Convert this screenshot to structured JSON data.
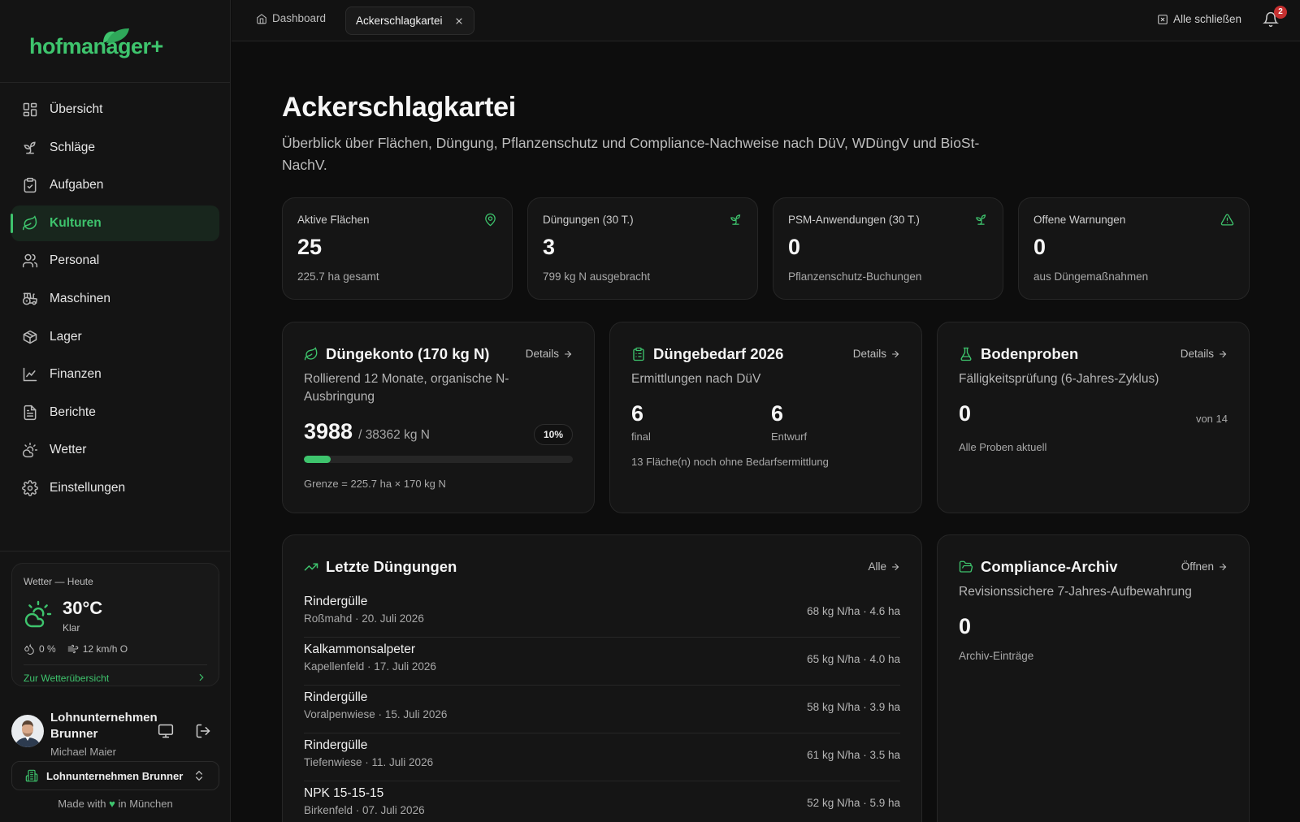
{
  "brand": {
    "name": "hofmanager+",
    "accent": "#3ec46d"
  },
  "nav": [
    {
      "label": "Übersicht",
      "icon": "grid-icon"
    },
    {
      "label": "Schläge",
      "icon": "sprout-icon"
    },
    {
      "label": "Aufgaben",
      "icon": "clipboard-check-icon"
    },
    {
      "label": "Kulturen",
      "icon": "leaf-icon",
      "active": true
    },
    {
      "label": "Personal",
      "icon": "users-icon"
    },
    {
      "label": "Maschinen",
      "icon": "tractor-icon"
    },
    {
      "label": "Lager",
      "icon": "package-icon"
    },
    {
      "label": "Finanzen",
      "icon": "chart-line-icon"
    },
    {
      "label": "Berichte",
      "icon": "file-text-icon"
    },
    {
      "label": "Wetter",
      "icon": "cloud-sun-icon"
    },
    {
      "label": "Einstellungen",
      "icon": "gear-icon"
    }
  ],
  "weather": {
    "title": "Wetter — Heute",
    "temp": "30°C",
    "condition": "Klar",
    "precip": "0 %",
    "wind": "12 km/h O",
    "link": "Zur Wetterübersicht"
  },
  "user": {
    "company": "Lohnunternehmen Brunner",
    "name": "Michael Maier",
    "org_select": "Lohnunternehmen Brunner"
  },
  "footer": {
    "made_prefix": "Made with",
    "heart": "♥",
    "made_suffix": "in München"
  },
  "topbar": {
    "tab_dashboard": "Dashboard",
    "tab_active": "Ackerschlagkartei",
    "close_all": "Alle schließen",
    "notifications": "2"
  },
  "page": {
    "title": "Ackerschlagkartei",
    "subtitle": "Überblick über Flächen, Düngung, Pflanzenschutz und Compliance-Nachweise nach DüV, WDüngV und BioSt-NachV."
  },
  "stats": [
    {
      "label": "Aktive Flächen",
      "value": "25",
      "sub": "225.7 ha gesamt",
      "icon": "map-pin-icon"
    },
    {
      "label": "Düngungen (30 T.)",
      "value": "3",
      "sub": "799 kg N ausgebracht",
      "icon": "sprout-icon"
    },
    {
      "label": "PSM-Anwendungen (30 T.)",
      "value": "0",
      "sub": "Pflanzenschutz-Buchungen",
      "icon": "sprout-icon"
    },
    {
      "label": "Offene Warnungen",
      "value": "0",
      "sub": "aus Düngemaßnahmen",
      "icon": "warning-icon"
    }
  ],
  "duengekonto": {
    "title": "Düngekonto (170 kg N)",
    "link": "Details",
    "desc": "Rollierend 12 Monate, organische N-Ausbringung",
    "value": "3988",
    "limit": "/ 38362 kg N",
    "percent_label": "10%",
    "progress": 0.1,
    "footnote": "Grenze = 225.7 ha × 170 kg N"
  },
  "duengebedarf": {
    "title": "Düngebedarf 2026",
    "link": "Details",
    "desc": "Ermittlungen nach DüV",
    "final_value": "6",
    "final_label": "final",
    "draft_value": "6",
    "draft_label": "Entwurf",
    "note": "13 Fläche(n) noch ohne Bedarfsermittlung"
  },
  "bodenproben": {
    "title": "Bodenproben",
    "link": "Details",
    "desc": "Fälligkeitsprüfung (6-Jahres-Zyklus)",
    "value": "0",
    "of": "von 14",
    "note": "Alle Proben aktuell"
  },
  "letzte": {
    "title": "Letzte Düngungen",
    "link": "Alle",
    "rows": [
      {
        "name": "Rindergülle",
        "meta": "Roßmahd · 20. Juli 2026",
        "amount": "68 kg N/ha · 4.6 ha"
      },
      {
        "name": "Kalkammonsalpeter",
        "meta": "Kapellenfeld · 17. Juli 2026",
        "amount": "65 kg N/ha · 4.0 ha"
      },
      {
        "name": "Rindergülle",
        "meta": "Voralpenwiese · 15. Juli 2026",
        "amount": "58 kg N/ha · 3.9 ha"
      },
      {
        "name": "Rindergülle",
        "meta": "Tiefenwiese · 11. Juli 2026",
        "amount": "61 kg N/ha · 3.5 ha"
      },
      {
        "name": "NPK 15-15-15",
        "meta": "Birkenfeld · 07. Juli 2026",
        "amount": "52 kg N/ha · 5.9 ha"
      }
    ]
  },
  "archiv": {
    "title": "Compliance-Archiv",
    "link": "Öffnen",
    "desc": "Revisionssichere 7-Jahres-Aufbewahrung",
    "value": "0",
    "note": "Archiv-Einträge"
  }
}
